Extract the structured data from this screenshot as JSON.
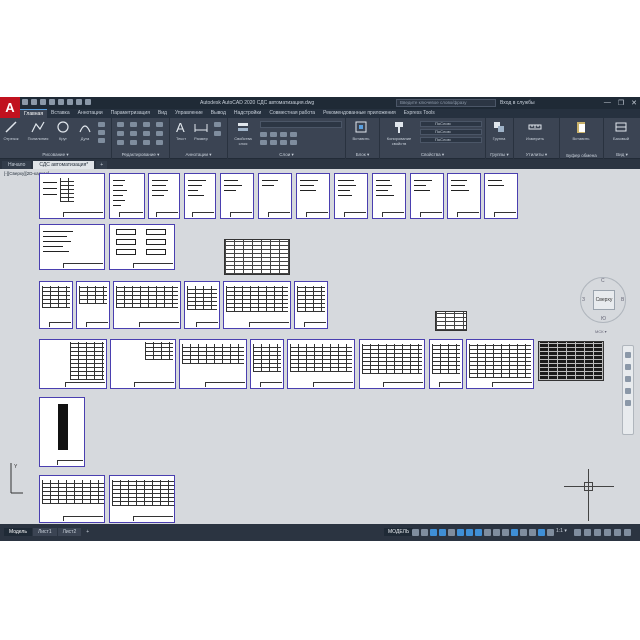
{
  "app": {
    "logo_letter": "A",
    "title": "Autodesk AutoCAD 2020   СДС автоматизация.dwg",
    "search_placeholder": "Введите ключевое слово/фразу",
    "user": "Вход в службы",
    "window_controls": [
      "—",
      "❐",
      "✕"
    ]
  },
  "ribbon_tabs": [
    "Главная",
    "Вставка",
    "Аннотации",
    "Параметризация",
    "Вид",
    "Управление",
    "Вывод",
    "Надстройки",
    "Совместная работа",
    "Рекомендованные приложения",
    "Express Tools"
  ],
  "ribbon": {
    "draw": {
      "tools": [
        "Отрезок",
        "Полилиния",
        "Круг",
        "Дуга"
      ],
      "label": "Рисование ▾"
    },
    "modify": {
      "label": "Редактирование ▾"
    },
    "annotation": {
      "tools": [
        "Текст",
        "Размер"
      ],
      "label": "Аннотации ▾"
    },
    "layers": {
      "tools": [
        "Свойства слоя"
      ],
      "label": "Слои ▾"
    },
    "block": {
      "tools": [
        "Вставить"
      ],
      "label": "Блок ▾"
    },
    "properties": {
      "tools": [
        "Копирование свойств"
      ],
      "values": [
        "ПоСлою",
        "ПоСлою",
        "ПоСлою"
      ],
      "label": "Свойства ▾"
    },
    "groups": {
      "tools": [
        "Группа"
      ],
      "label": "Группы ▾"
    },
    "utilities": {
      "tools": [
        "Измерить"
      ],
      "label": "Утилиты ▾"
    },
    "clipboard": {
      "tools": [
        "Вставить"
      ],
      "label": "Буфер обмена"
    },
    "view": {
      "tools": [
        "Базовый"
      ],
      "label": "Вид ▾"
    }
  },
  "file_tabs": [
    "Начало",
    "СДС автоматизация*"
  ],
  "drawing": {
    "viewport_label": "[-][Сверху][2D-каркас]",
    "viewcube": {
      "face": "Сверху",
      "north": "С",
      "south": "Ю",
      "west": "З",
      "east": "В"
    },
    "wcs": "МСК ▾"
  },
  "status": {
    "layout_tabs": [
      "Модель",
      "Лист1",
      "Лист2"
    ],
    "add_tab": "+",
    "model": "МОДЕЛЬ",
    "scale": "1:1 ▾"
  },
  "colors": {
    "accent": "#3f8fd6",
    "logo": "#c1121f",
    "frame": "#4a3fb0",
    "canvas": "#d6d9dd"
  }
}
